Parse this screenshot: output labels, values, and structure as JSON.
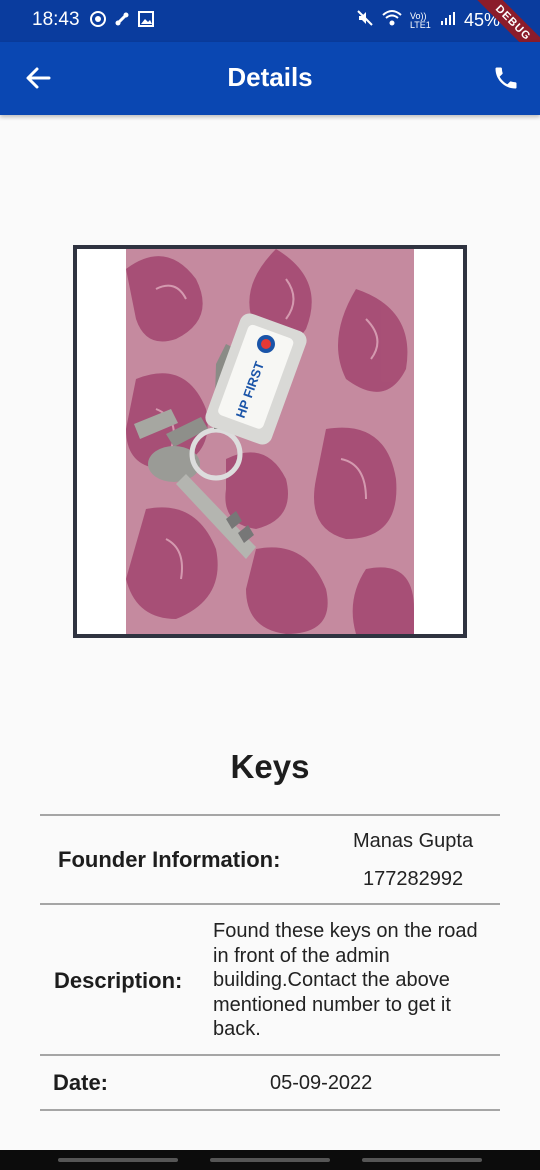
{
  "status_bar": {
    "time": "18:43",
    "battery": "45%",
    "network": "Vo)) LTE1",
    "debug_label": "DEBUG"
  },
  "app_bar": {
    "title": "Details"
  },
  "item": {
    "title": "Keys",
    "keychain_text": "HP FIRST"
  },
  "details": {
    "founder_label": "Founder Information:",
    "founder_name": "Manas Gupta",
    "founder_phone": "177282992",
    "description_label": "Description:",
    "description_lines": [
      "Found these keys on the road",
      "in front of the admin",
      "building.Contact the above",
      "mentioned number to get it",
      "back."
    ],
    "date_label": "Date:",
    "date_value": "05-09-2022"
  },
  "colors": {
    "app_bar": "#0a47b2",
    "status_bar": "#0a3c9e",
    "frame": "#2f3340"
  }
}
